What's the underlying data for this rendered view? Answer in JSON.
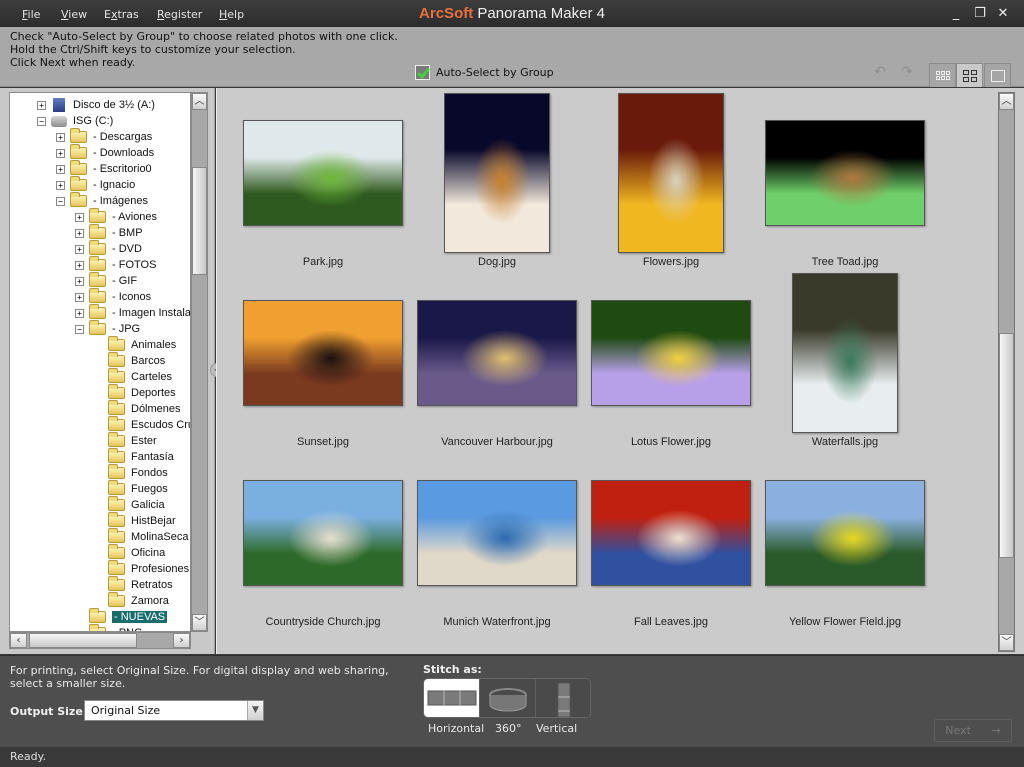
{
  "titlebar": {
    "brand": "ArcSoft",
    "product": "Panorama Maker 4",
    "menu": [
      {
        "label": "File",
        "accel": "F",
        "rest": "ile"
      },
      {
        "label": "View",
        "accel": "V",
        "rest": "iew"
      },
      {
        "label": "Extras",
        "pre": "E",
        "accel": "x",
        "rest": "tras"
      },
      {
        "label": "Register",
        "accel": "R",
        "rest": "egister"
      },
      {
        "label": "Help",
        "accel": "H",
        "rest": "elp"
      }
    ],
    "window_controls": [
      "minimize-icon",
      "restore-icon",
      "close-icon"
    ]
  },
  "instructions": {
    "line1": "Check \"Auto-Select by Group\" to choose related photos with one click.",
    "line2": "Hold the Ctrl/Shift keys to customize your selection.",
    "line3": "Click Next when ready."
  },
  "autoselect": {
    "label": "Auto-Select by Group",
    "checked": true
  },
  "toolbar": {
    "rotate_left": "rotate-left-icon",
    "rotate_right": "rotate-right-icon",
    "view_modes": [
      "small-thumbnails",
      "medium-thumbnails",
      "large-single"
    ],
    "active_view": "medium-thumbnails"
  },
  "tree": {
    "nodes": [
      {
        "label": "Disco de 3½ (A:)",
        "icon": "floppy",
        "level": 1,
        "expander": "+"
      },
      {
        "label": "ISG (C:)",
        "icon": "drive",
        "level": 1,
        "expander": "-"
      },
      {
        "label": "- Descargas",
        "icon": "folder",
        "level": 2,
        "expander": "+"
      },
      {
        "label": "- Downloads",
        "icon": "folder",
        "level": 2,
        "expander": "+"
      },
      {
        "label": "- Escritorio0",
        "icon": "folder",
        "level": 2,
        "expander": "+"
      },
      {
        "label": "- Ignacio",
        "icon": "folder",
        "level": 2,
        "expander": "+"
      },
      {
        "label": "- Imágenes",
        "icon": "folder",
        "level": 2,
        "expander": "-"
      },
      {
        "label": "- Aviones",
        "icon": "folder",
        "level": 3,
        "expander": "+"
      },
      {
        "label": "- BMP",
        "icon": "folder",
        "level": 3,
        "expander": "+"
      },
      {
        "label": "- DVD",
        "icon": "folder",
        "level": 3,
        "expander": "+"
      },
      {
        "label": "- FOTOS",
        "icon": "folder",
        "level": 3,
        "expander": "+"
      },
      {
        "label": "- GIF",
        "icon": "folder",
        "level": 3,
        "expander": "+"
      },
      {
        "label": "- Iconos",
        "icon": "folder",
        "level": 3,
        "expander": "+"
      },
      {
        "label": "- Imagen Instalat",
        "icon": "folder",
        "level": 3,
        "expander": "+"
      },
      {
        "label": "- JPG",
        "icon": "folder",
        "level": 3,
        "expander": "-"
      },
      {
        "label": "Animales",
        "icon": "folder",
        "level": 4,
        "expander": ""
      },
      {
        "label": "Barcos",
        "icon": "folder",
        "level": 4,
        "expander": ""
      },
      {
        "label": "Carteles",
        "icon": "folder",
        "level": 4,
        "expander": ""
      },
      {
        "label": "Deportes",
        "icon": "folder",
        "level": 4,
        "expander": ""
      },
      {
        "label": "Dólmenes",
        "icon": "folder",
        "level": 4,
        "expander": ""
      },
      {
        "label": "Escudos Cru",
        "icon": "folder",
        "level": 4,
        "expander": ""
      },
      {
        "label": "Ester",
        "icon": "folder",
        "level": 4,
        "expander": ""
      },
      {
        "label": "Fantasía",
        "icon": "folder",
        "level": 4,
        "expander": ""
      },
      {
        "label": "Fondos",
        "icon": "folder",
        "level": 4,
        "expander": ""
      },
      {
        "label": "Fuegos",
        "icon": "folder",
        "level": 4,
        "expander": ""
      },
      {
        "label": "Galicia",
        "icon": "folder",
        "level": 4,
        "expander": ""
      },
      {
        "label": "HistBejar",
        "icon": "folder",
        "level": 4,
        "expander": ""
      },
      {
        "label": "MolinaSeca",
        "icon": "folder",
        "level": 4,
        "expander": ""
      },
      {
        "label": "Oficina",
        "icon": "folder",
        "level": 4,
        "expander": ""
      },
      {
        "label": "Profesiones",
        "icon": "folder",
        "level": 4,
        "expander": ""
      },
      {
        "label": "Retratos",
        "icon": "folder",
        "level": 4,
        "expander": ""
      },
      {
        "label": "Zamora",
        "icon": "folder",
        "level": 4,
        "expander": ""
      },
      {
        "label": "- NUEVAS",
        "icon": "folder-open",
        "level": 3,
        "expander": "",
        "selected": true
      },
      {
        "label": "- PNG",
        "icon": "folder",
        "level": 3,
        "expander": ""
      }
    ]
  },
  "photos": [
    {
      "name": "Park.jpg",
      "orientation": "landscape",
      "colors": [
        "#dfe8ea",
        "#2f5a1f",
        "#6fb83a"
      ]
    },
    {
      "name": "Dog.jpg",
      "orientation": "portrait",
      "colors": [
        "#08082a",
        "#f2e8dc",
        "#c9812f"
      ]
    },
    {
      "name": "Flowers.jpg",
      "orientation": "portrait",
      "colors": [
        "#6a1a0a",
        "#f0b820",
        "#d8d2c0"
      ]
    },
    {
      "name": "Tree Toad.jpg",
      "orientation": "landscape",
      "colors": [
        "#000000",
        "#6fcf6a",
        "#b07840"
      ]
    },
    {
      "name": "Sunset.jpg",
      "orientation": "landscape",
      "colors": [
        "#f0a030",
        "#7a3a20",
        "#1a1010"
      ]
    },
    {
      "name": "Vancouver Harbour.jpg",
      "orientation": "landscape",
      "colors": [
        "#1a1848",
        "#6a5a8a",
        "#e0c070"
      ]
    },
    {
      "name": "Lotus Flower.jpg",
      "orientation": "landscape",
      "colors": [
        "#1f4a12",
        "#b8a0e8",
        "#f0d040"
      ]
    },
    {
      "name": "Waterfalls.jpg",
      "orientation": "portrait",
      "colors": [
        "#3a3a2a",
        "#e8eef0",
        "#3a7a5a"
      ]
    },
    {
      "name": "Countryside Church.jpg",
      "orientation": "landscape",
      "colors": [
        "#7ab0e0",
        "#2d6a2a",
        "#e8e0d0"
      ]
    },
    {
      "name": "Munich Waterfront.jpg",
      "orientation": "landscape",
      "colors": [
        "#5a9ae0",
        "#e0d8c8",
        "#2a6ab0"
      ]
    },
    {
      "name": "Fall Leaves.jpg",
      "orientation": "landscape",
      "colors": [
        "#c02010",
        "#3050a0",
        "#f0e0d0"
      ]
    },
    {
      "name": "Yellow Flower Field.jpg",
      "orientation": "landscape",
      "colors": [
        "#8ab0e0",
        "#2a5a2a",
        "#e8d820"
      ]
    }
  ],
  "bottom": {
    "hint_line1": "For printing, select Original Size. For digital display and web sharing,",
    "hint_line2": "select a smaller size.",
    "output_label": "Output Size:",
    "output_value": "Original Size",
    "stitch_label": "Stitch as:",
    "stitch_options": [
      {
        "label": "Horizontal",
        "selected": true
      },
      {
        "label": "360°",
        "selected": false
      },
      {
        "label": "Vertical",
        "selected": false
      }
    ],
    "next_label": "Next",
    "next_enabled": false
  },
  "status": {
    "text": "Ready."
  }
}
